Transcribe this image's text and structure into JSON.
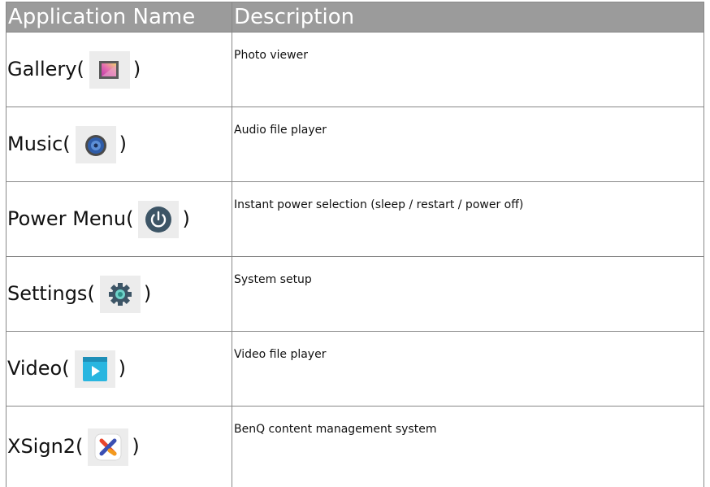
{
  "table": {
    "header": {
      "col1": "Application Name",
      "col2": "Description"
    },
    "rows": [
      {
        "name": "Gallery(",
        "close": ")",
        "icon": "gallery-icon",
        "description": "Photo viewer"
      },
      {
        "name": "Music(",
        "close": ")",
        "icon": "speaker-icon",
        "description": "Audio file player"
      },
      {
        "name": "Power Menu(",
        "close": ")",
        "icon": "power-icon",
        "description": "Instant power selection (sleep / restart / power off)"
      },
      {
        "name": "Settings(",
        "close": ")",
        "icon": "gear-icon",
        "description": "System setup"
      },
      {
        "name": "Video(",
        "close": ")",
        "icon": "video-play-icon",
        "description": "Video file player"
      },
      {
        "name": "XSign2(",
        "close": ")",
        "icon": "xsign-icon",
        "description": "BenQ content management system"
      }
    ]
  },
  "colors": {
    "header_bg": "#9b9b9b",
    "header_text": "#ffffff",
    "border": "#888888"
  }
}
